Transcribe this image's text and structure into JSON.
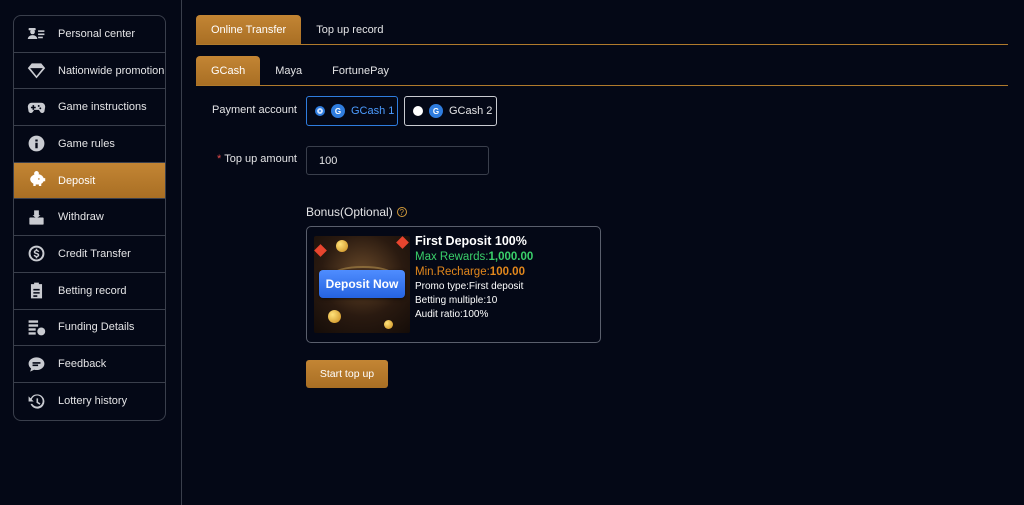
{
  "sidebar": {
    "items": [
      {
        "label": "Personal center",
        "icon": "user-card-icon"
      },
      {
        "label": "Nationwide promotion",
        "icon": "diamond-icon"
      },
      {
        "label": "Game instructions",
        "icon": "gamepad-icon"
      },
      {
        "label": "Game rules",
        "icon": "info-icon"
      },
      {
        "label": "Deposit",
        "icon": "piggy-bank-icon",
        "active": true
      },
      {
        "label": "Withdraw",
        "icon": "withdraw-icon"
      },
      {
        "label": "Credit Transfer",
        "icon": "dollar-circle-icon"
      },
      {
        "label": "Betting record",
        "icon": "clipboard-icon"
      },
      {
        "label": "Funding Details",
        "icon": "coins-list-icon"
      },
      {
        "label": "Feedback",
        "icon": "chat-bubble-icon"
      },
      {
        "label": "Lottery history",
        "icon": "history-icon"
      }
    ]
  },
  "tabs": {
    "main": [
      "Online Transfer",
      "Top up record"
    ],
    "main_active": "Online Transfer",
    "methods": [
      "GCash",
      "Maya",
      "FortunePay"
    ],
    "methods_active": "GCash"
  },
  "form": {
    "payment_account_label": "Payment account",
    "payment_options": [
      {
        "label": "GCash 1",
        "selected": true
      },
      {
        "label": "GCash 2",
        "selected": false
      }
    ],
    "required_marker": "*",
    "amount_label": "Top up amount",
    "amount_value": "100"
  },
  "bonus": {
    "title": "Bonus(Optional)",
    "help_glyph": "?",
    "card": {
      "image_button": "Deposit Now",
      "title": "First Deposit 100%",
      "max_rewards_label": "Max Rewards:",
      "max_rewards_value": "1,000.00",
      "min_recharge_label": "Min.Recharge:",
      "min_recharge_value": "100.00",
      "promo_type": "Promo type:First deposit",
      "betting_multiple": "Betting multiple:10",
      "audit_ratio": "Audit ratio:100%"
    }
  },
  "start_button": "Start top up",
  "colors": {
    "accent": "#b8792c",
    "background": "#040816",
    "selected_blue": "#2f7ddf",
    "green": "#3ad06a",
    "orange": "#e2871c"
  }
}
